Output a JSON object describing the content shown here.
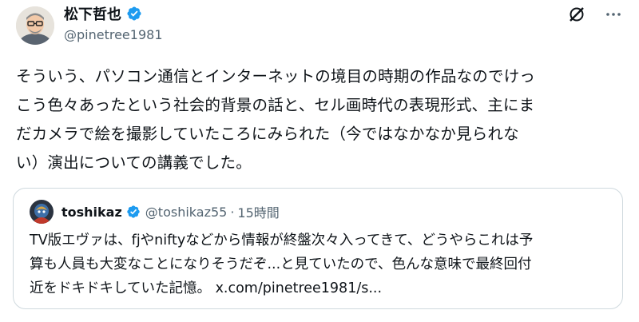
{
  "post": {
    "author": {
      "display_name": "松下哲也",
      "handle": "@pinetree1981",
      "verified": true
    },
    "icons": [
      "grok-icon",
      "more-icon"
    ],
    "text_lines": [
      "そういう、パソコン通信とインターネットの境目の時期の作品なのでけっ",
      "こう色々あったという社会的背景の話と、セル画時代の表現形式、主にま",
      "だカメラで絵を撮影していたころにみられた（今ではなかなか見られな",
      "い）演出についての講義でした。"
    ]
  },
  "quote": {
    "author": {
      "display_name": "toshikaz",
      "handle": "@toshikaz55",
      "verified": true
    },
    "separator": "·",
    "time": "15時間",
    "text_lines": [
      "TV版エヴァは、fjやniftyなどから情報が終盤次々入ってきて、どうやらこれは予",
      "算も人員も大変なことになりそうだぞ...と見ていたので、色んな意味で最終回付",
      "近をドキドキしていた記憶。"
    ],
    "link": "x.com/pinetree1981/s..."
  },
  "colors": {
    "verified": "#1d9bf0",
    "text": "#0f1419",
    "secondary": "#536471",
    "border": "#cfd9de"
  }
}
